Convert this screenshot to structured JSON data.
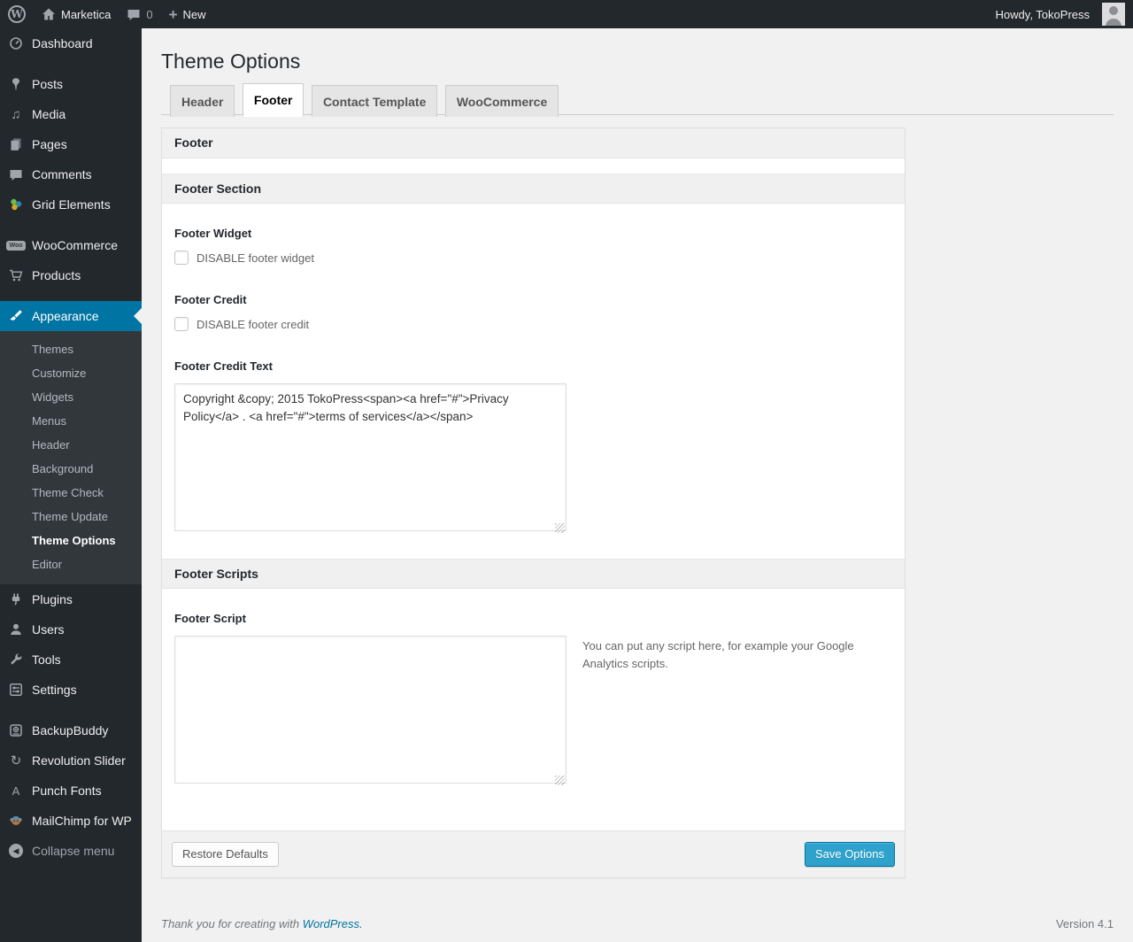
{
  "admin_bar": {
    "site_name": "Marketica",
    "comment_count": "0",
    "new_label": "New",
    "howdy": "Howdy, TokoPress"
  },
  "sidebar": {
    "items": [
      "Dashboard",
      "Posts",
      "Media",
      "Pages",
      "Comments",
      "Grid Elements",
      "WooCommerce",
      "Products",
      "Appearance",
      "Plugins",
      "Users",
      "Tools",
      "Settings",
      "BackupBuddy",
      "Revolution Slider",
      "Punch Fonts",
      "MailChimp for WP",
      "Collapse menu"
    ],
    "appearance_submenu": [
      "Themes",
      "Customize",
      "Widgets",
      "Menus",
      "Header",
      "Background",
      "Theme Check",
      "Theme Update",
      "Theme Options",
      "Editor"
    ],
    "current_item": "Appearance",
    "current_submenu_item": "Theme Options"
  },
  "page": {
    "title": "Theme Options",
    "tabs": [
      "Header",
      "Footer",
      "Contact Template",
      "WooCommerce"
    ],
    "active_tab": "Footer"
  },
  "panel": {
    "footer_bar_title": "Footer",
    "footer_section_title": "Footer Section",
    "footer_widget_label": "Footer Widget",
    "footer_widget_checkbox_label": "DISABLE footer widget",
    "footer_credit_label": "Footer Credit",
    "footer_credit_checkbox_label": "DISABLE footer credit",
    "footer_credit_text_label": "Footer Credit Text",
    "footer_credit_text_value": "Copyright &copy; 2015 TokoPress<span><a href=\"#\">Privacy Policy</a> . <a href=\"#\">terms of services</a></span>",
    "footer_scripts_title": "Footer Scripts",
    "footer_script_label": "Footer Script",
    "footer_script_value": "",
    "footer_script_description": "You can put any script here, for example your Google Analytics scripts.",
    "restore_button_label": "Restore Defaults",
    "save_button_label": "Save Options"
  },
  "page_footer": {
    "thanks_text": "Thank you for creating with",
    "wordpress_link": "WordPress.",
    "version": "Version 4.1"
  },
  "icons": {
    "media_glyph": "♫",
    "revolution_slider_glyph": "↻",
    "punch_fonts_glyph": "A",
    "collapse_glyph": "◀"
  },
  "colors": {
    "admin_dark": "#23282d",
    "submenu_dark": "#32373c",
    "menu_highlight": "#0074a2",
    "primary_button": "#2ea2cc",
    "page_background": "#f1f1f1",
    "link_blue": "#0074a2"
  }
}
